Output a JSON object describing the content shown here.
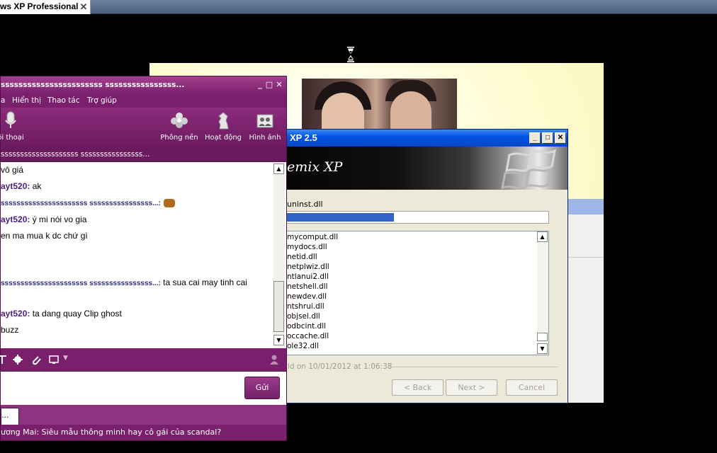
{
  "vm": {
    "tab_title": "ws XP Professional",
    "tab_close": "✕"
  },
  "installer": {
    "title": ": XP 2.5",
    "banner_text": "emix XP",
    "current_file": "uninst.dll",
    "progress_fraction": 0.41,
    "files": [
      "mycomput.dll",
      "mydocs.dll",
      "netid.dll",
      "netplwiz.dll",
      "ntlanui2.dll",
      "netshell.dll",
      "newdev.dll",
      "ntshrui.dll",
      "objsel.dll",
      "odbcint.dll",
      "occache.dll",
      "ole32.dll"
    ],
    "build_text": "ild on 10/01/2012 at 1:06:38",
    "buttons": {
      "back": "< Back",
      "next": "Next >",
      "cancel": "Cancel"
    }
  },
  "messenger": {
    "title": "sssssssssssssssssssssss ssssssssssssssss...",
    "menu": [
      "a",
      "Hiển thị",
      "Thao tác",
      "Trợ giúp"
    ],
    "toolbar": {
      "voice": "ội thoại",
      "wallpaper": "Phông nền",
      "activities": "Hoạt động",
      "photos": "Hình ảnh"
    },
    "status_line": "ssssssssssssssssssss ssssssssssssssss...",
    "chat": [
      {
        "nick": "",
        "text": "vô giá"
      },
      {
        "nick": "ayt520:",
        "text": " ak"
      },
      {
        "nick": "ssssssssssssssssssssss ssssssssssssssss...:",
        "text": ""
      },
      {
        "nick": "ayt520:",
        "text": " ý mi nói vo gia"
      },
      {
        "nick": "",
        "text": "en ma mua k dc chứ gì"
      },
      {
        "nick": "ssssssssssssssssssssss ssssssssssssssss...:",
        "text": " ta sua cai may tinh cai"
      },
      {
        "nick": "ayt520:",
        "text": " ta dang quay Clip ghost"
      },
      {
        "nick": "",
        "text": "buzz"
      }
    ],
    "send_label": "Gửi",
    "tab_label": "...",
    "ticker": "ương Mai: Siêu mẫu thông minh hay cô gái của scandal?"
  },
  "colors": {
    "ym_purple": "#7a1f6b",
    "xp_blue": "#0554e4",
    "progress": "#3062c8"
  }
}
